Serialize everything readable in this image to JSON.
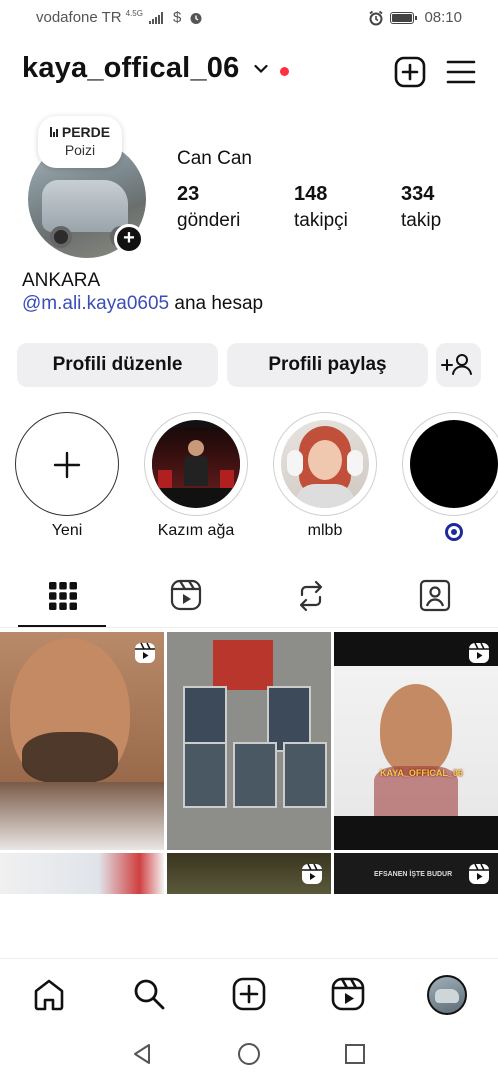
{
  "status_bar": {
    "carrier": "vodafone TR",
    "network": "4.5G",
    "time": "08:10"
  },
  "header": {
    "username": "kaya_offical_06",
    "icons": [
      "chevron-down-icon",
      "create-icon",
      "menu-icon"
    ]
  },
  "profile": {
    "note_title": "PERDE",
    "note_subtitle": "Poizi",
    "full_name": "Can Can",
    "stats": [
      {
        "value": "23",
        "label": "gönderi"
      },
      {
        "value": "148",
        "label": "takipçi"
      },
      {
        "value": "334",
        "label": "takip"
      }
    ],
    "bio_line1": "ANKARA",
    "bio_mention": "@m.ali.kaya0605",
    "bio_suffix": "ana hesap"
  },
  "actions": {
    "edit_label": "Profili düzenle",
    "share_label": "Profili paylaş"
  },
  "highlights": [
    {
      "label": "Yeni"
    },
    {
      "label": "Kazım ağa"
    },
    {
      "label": "mlbb"
    },
    {
      "label": ""
    }
  ],
  "tabs": [
    "grid-icon",
    "reels-icon",
    "reposts-icon",
    "tagged-icon"
  ],
  "grid_overlays": {
    "post3_text": "KAYA_OFFICAL_06",
    "post6_text": "EFSANEN İŞTE BUDUR"
  },
  "colors": {
    "accent_link": "#3a4db8",
    "live_dot": "#ff3040",
    "button_bg": "#efeff1"
  }
}
